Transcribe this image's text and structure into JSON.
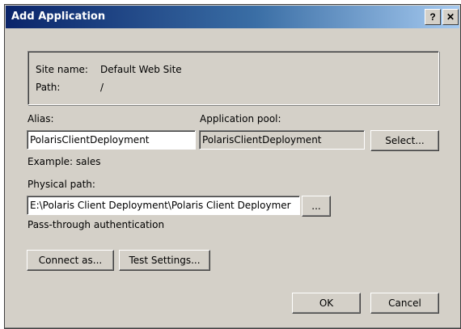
{
  "window": {
    "title": "Add Application",
    "help_glyph": "?",
    "close_glyph": "✕"
  },
  "info": {
    "site_name_label": "Site name:",
    "site_name_value": "Default Web Site",
    "path_label": "Path:",
    "path_value": "/"
  },
  "alias": {
    "label": "Alias:",
    "value": "PolarisClientDeployment",
    "example": "Example: sales"
  },
  "application_pool": {
    "label": "Application pool:",
    "value": "PolarisClientDeployment",
    "select_label": "Select..."
  },
  "physical_path": {
    "label": "Physical path:",
    "value": "E:\\Polaris Client Deployment\\Polaris Client Deploymer",
    "browse_label": "..."
  },
  "auth": {
    "label": "Pass-through authentication",
    "connect_as_label": "Connect as...",
    "test_settings_label": "Test Settings..."
  },
  "actions": {
    "ok_label": "OK",
    "cancel_label": "Cancel"
  },
  "colors": {
    "dialog_background": "#d4d0c8",
    "titlebar_start": "#0a246a",
    "titlebar_end": "#a6caf0"
  }
}
